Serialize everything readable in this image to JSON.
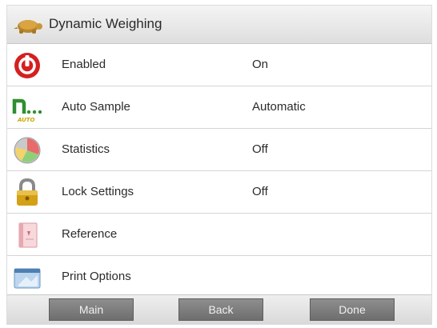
{
  "header": {
    "title": "Dynamic Weighing",
    "icon": "turtle-icon"
  },
  "rows": [
    {
      "label": "Enabled",
      "value": "On",
      "icon": "enabled-icon"
    },
    {
      "label": "Auto Sample",
      "value": "Automatic",
      "icon": "auto-sample-icon",
      "icon_text": "AUTO"
    },
    {
      "label": "Statistics",
      "value": "Off",
      "icon": "statistics-pie-icon"
    },
    {
      "label": "Lock Settings",
      "value": "Off",
      "icon": "lock-icon"
    },
    {
      "label": "Reference",
      "value": "",
      "icon": "reference-book-icon"
    },
    {
      "label": "Print Options",
      "value": "",
      "icon": "print-options-icon"
    }
  ],
  "footer": {
    "main_label": "Main",
    "back_label": "Back",
    "done_label": "Done"
  },
  "colors": {
    "accent_red": "#d42020",
    "accent_green": "#2f8f2f",
    "button_gray": "#7a7a7a",
    "lock_gold": "#d4a017"
  }
}
